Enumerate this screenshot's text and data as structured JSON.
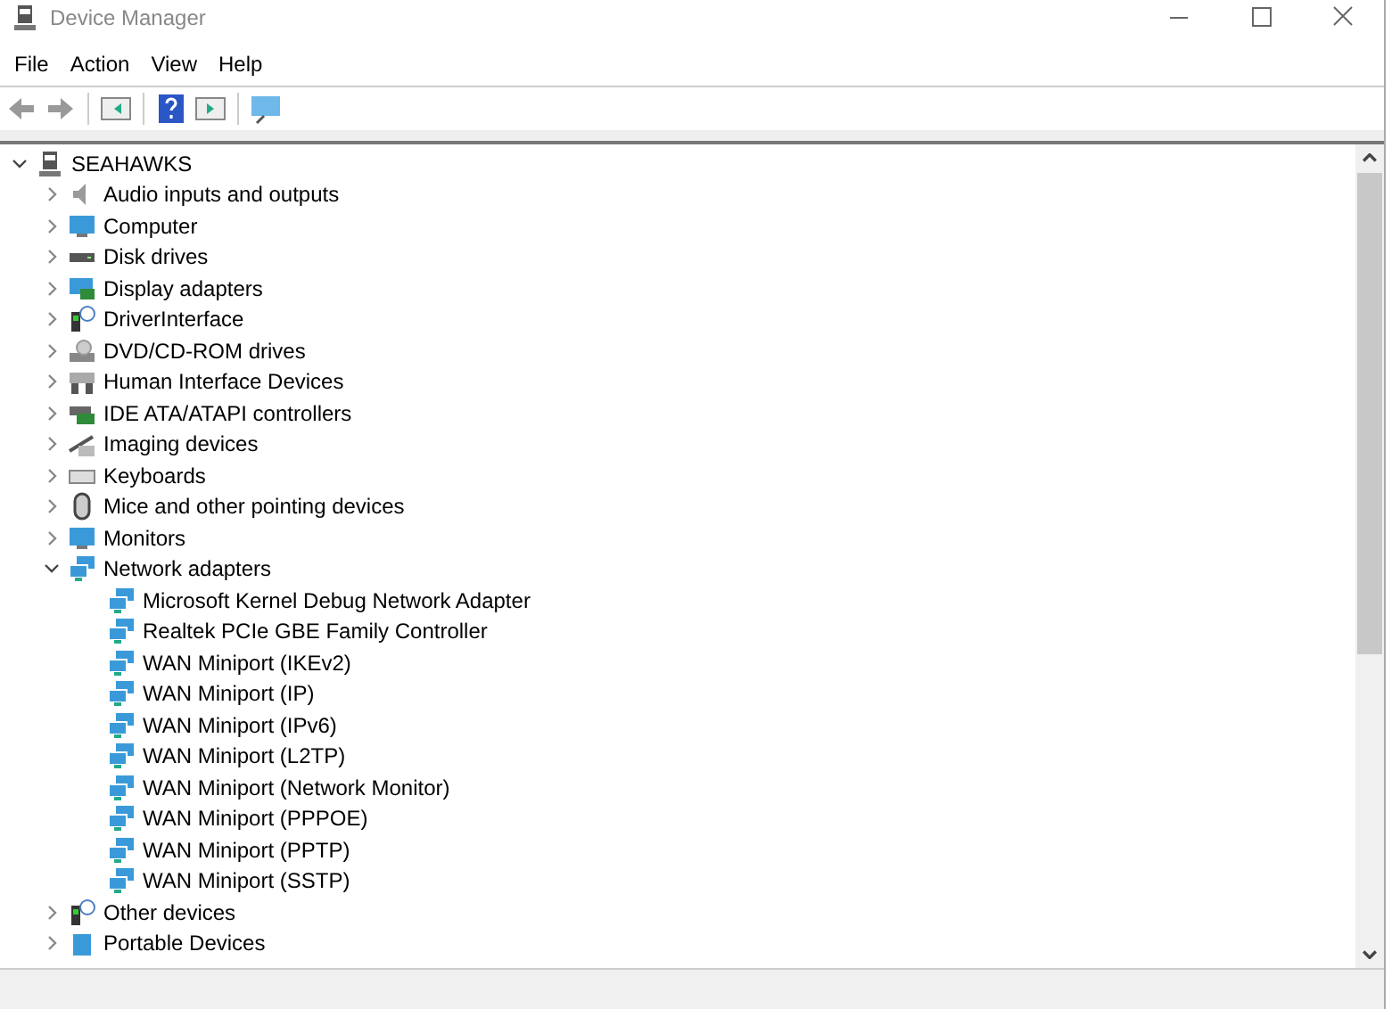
{
  "window": {
    "title": "Device Manager"
  },
  "menu": [
    "File",
    "Action",
    "View",
    "Help"
  ],
  "tree": {
    "label": "SEAHAWKS",
    "expanded": true,
    "children": [
      {
        "label": "Audio inputs and outputs",
        "expanded": false
      },
      {
        "label": "Computer",
        "expanded": false
      },
      {
        "label": "Disk drives",
        "expanded": false
      },
      {
        "label": "Display adapters",
        "expanded": false
      },
      {
        "label": "DriverInterface",
        "expanded": false
      },
      {
        "label": "DVD/CD-ROM drives",
        "expanded": false
      },
      {
        "label": "Human Interface Devices",
        "expanded": false
      },
      {
        "label": "IDE ATA/ATAPI controllers",
        "expanded": false
      },
      {
        "label": "Imaging devices",
        "expanded": false
      },
      {
        "label": "Keyboards",
        "expanded": false
      },
      {
        "label": "Mice and other pointing devices",
        "expanded": false
      },
      {
        "label": "Monitors",
        "expanded": false
      },
      {
        "label": "Network adapters",
        "expanded": true,
        "children": [
          {
            "label": "Microsoft Kernel Debug Network Adapter"
          },
          {
            "label": "Realtek PCIe GBE Family Controller"
          },
          {
            "label": "WAN Miniport (IKEv2)"
          },
          {
            "label": "WAN Miniport (IP)"
          },
          {
            "label": "WAN Miniport (IPv6)"
          },
          {
            "label": "WAN Miniport (L2TP)"
          },
          {
            "label": "WAN Miniport (Network Monitor)"
          },
          {
            "label": "WAN Miniport (PPPOE)"
          },
          {
            "label": "WAN Miniport (PPTP)"
          },
          {
            "label": "WAN Miniport (SSTP)"
          }
        ]
      },
      {
        "label": "Other devices",
        "expanded": false
      },
      {
        "label": "Portable Devices",
        "expanded": false
      }
    ]
  }
}
